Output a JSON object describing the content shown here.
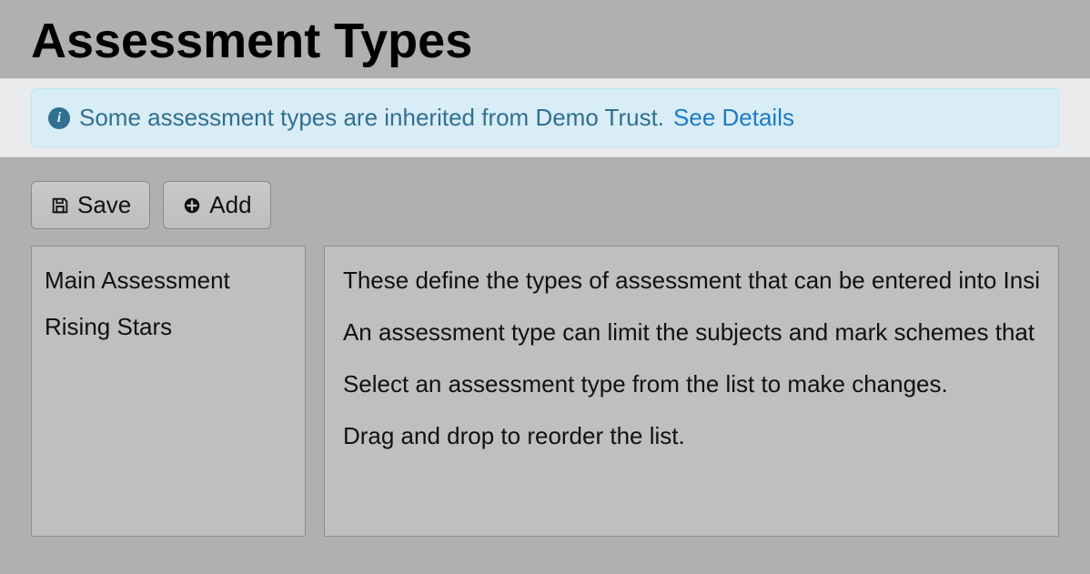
{
  "header": {
    "title": "Assessment Types"
  },
  "alert": {
    "text_before": "Some assessment types are inherited from Demo Trust. ",
    "link_text": "See Details"
  },
  "toolbar": {
    "save_label": "Save",
    "add_label": "Add"
  },
  "sidebar": {
    "items": [
      {
        "label": "Main Assessment"
      },
      {
        "label": "Rising Stars"
      }
    ]
  },
  "detail": {
    "paragraphs": [
      "These define the types of assessment that can be entered into Insi",
      "An assessment type can limit the subjects and mark schemes that",
      "Select an assessment type from the list to make changes.",
      "Drag and drop to reorder the list."
    ]
  }
}
